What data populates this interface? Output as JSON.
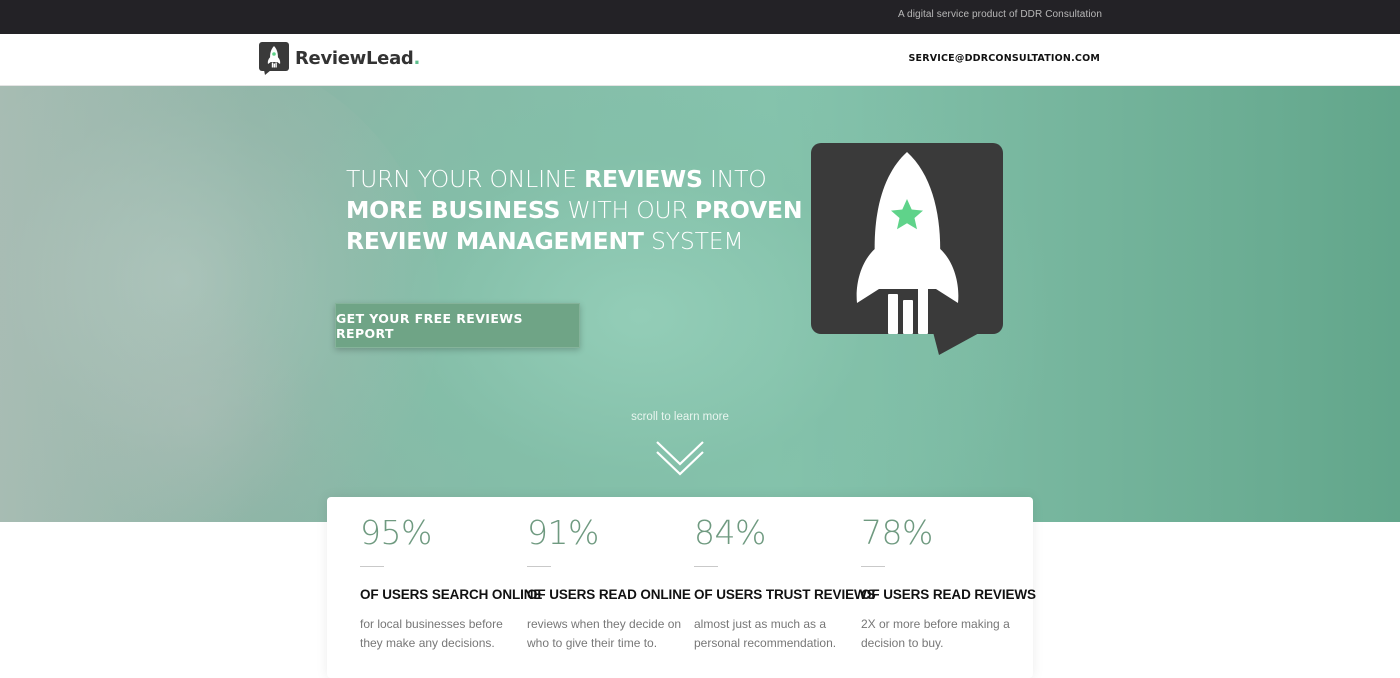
{
  "topbar": {
    "text": "A digital service product of DDR Consultation"
  },
  "header": {
    "logo": {
      "name": "ReviewLead",
      "dot": ".",
      "icon": "rocket-icon"
    },
    "email": "SERVICE@DDRCONSULTATION.COM"
  },
  "hero": {
    "headline_parts": [
      {
        "text": "TURN YOUR ONLINE ",
        "bold": false
      },
      {
        "text": "REVIEWS",
        "bold": true
      },
      {
        "text": " INTO ",
        "bold": false
      },
      {
        "text": "MORE BUSINESS",
        "bold": true
      },
      {
        "text": " WITH OUR ",
        "bold": false
      },
      {
        "text": "PROVEN REVIEW MANAGEMENT",
        "bold": true
      },
      {
        "text": " SYSTEM",
        "bold": false
      }
    ],
    "cta_label": "GET YOUR FREE REVIEWS REPORT",
    "scroll_text": "scroll to learn more",
    "scroll_icon": "chevron-double-down-icon",
    "logo_icon": "rocket-icon"
  },
  "colors": {
    "accent_green": "#6fa486",
    "stat_green": "#6f9a80",
    "star_green": "#5fd38a",
    "dark": "#3a3a3a"
  },
  "stats": [
    {
      "value": "95%",
      "heading": "OF USERS SEARCH ONLINE",
      "description": "for local businesses before they make any decisions."
    },
    {
      "value": "91%",
      "heading": "OF USERS READ ONLINE",
      "description": "reviews when they decide on who to give their time to."
    },
    {
      "value": "84%",
      "heading": "OF USERS TRUST REVIEWS",
      "description": "almost just as much as a personal recommendation."
    },
    {
      "value": "78%",
      "heading": "OF USERS READ REVIEWS",
      "description": "2X or more before making a decision to buy."
    }
  ]
}
